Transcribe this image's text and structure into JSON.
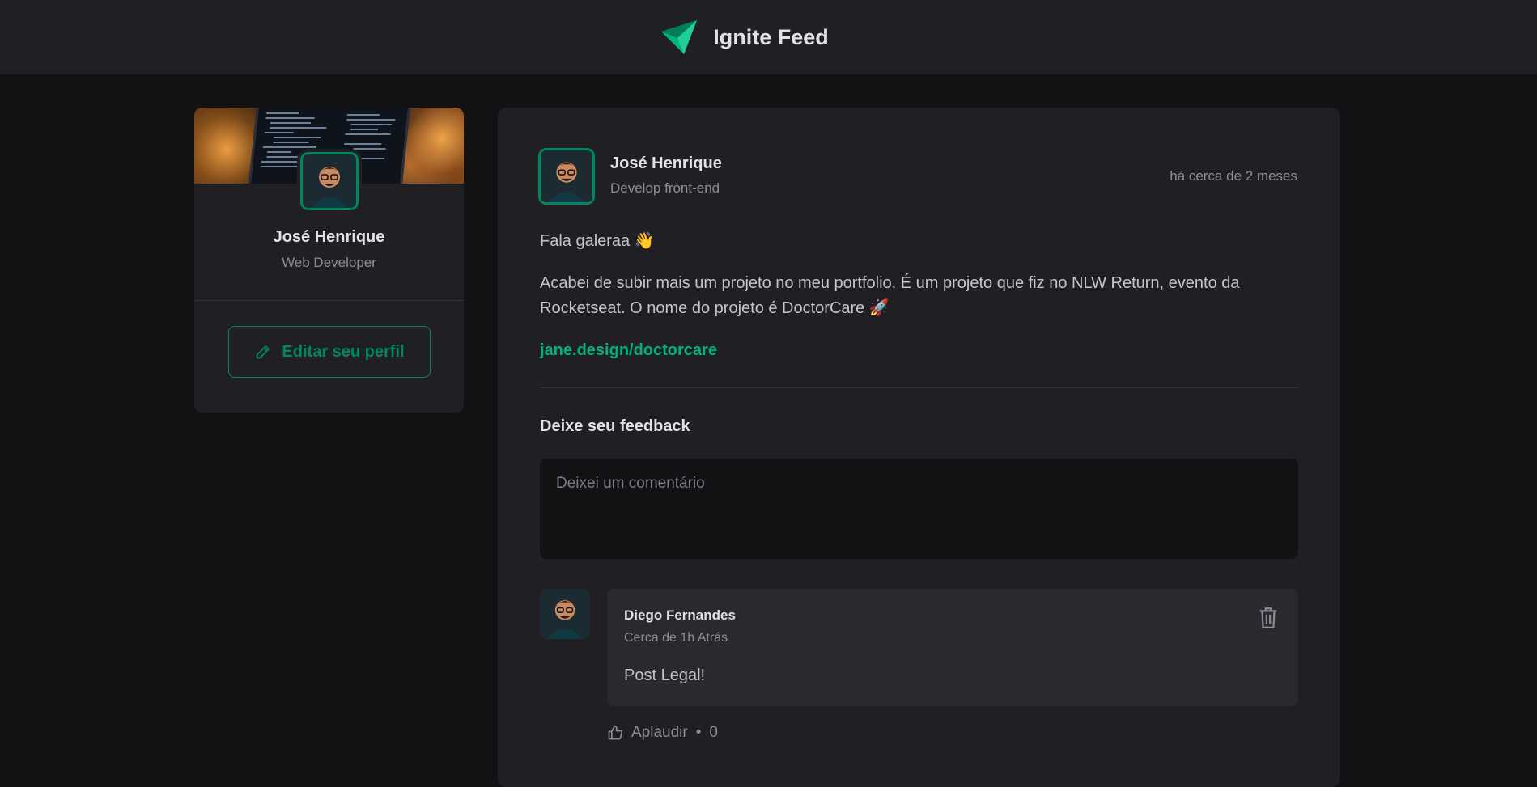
{
  "header": {
    "title": "Ignite Feed",
    "logo_icon": "ignite-logo"
  },
  "profile": {
    "name": "José Henrique",
    "role": "Web Developer",
    "edit_label": "Editar seu perfil",
    "edit_icon": "pencil-icon"
  },
  "post": {
    "author": {
      "name": "José Henrique",
      "role": "Develop front-end"
    },
    "time": "há cerca de 2 meses",
    "paragraphs": [
      "Fala galeraa 👋",
      "Acabei de subir mais um projeto no meu portfolio. É um projeto que fiz no NLW Return, evento da Rocketseat. O nome do projeto é DoctorCare 🚀"
    ],
    "link": "jane.design/doctorcare",
    "feedback_title": "Deixe seu feedback",
    "comment_placeholder": "Deixei um comentário"
  },
  "comment": {
    "author": "Diego Fernandes",
    "time": "Cerca de 1h Atrás",
    "text": "Post Legal!",
    "applaud_label": "Aplaudir",
    "applaud_separator": "•",
    "applaud_count": "0",
    "delete_icon": "trash-icon",
    "like_icon": "thumbs-up-icon"
  },
  "colors": {
    "background": "#121214",
    "surface": "#202024",
    "accent": "#00875f",
    "link": "#00b37e"
  }
}
